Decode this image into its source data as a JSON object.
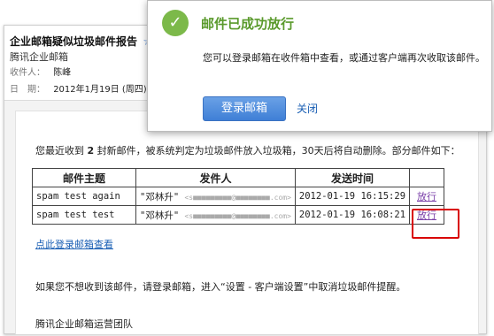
{
  "email": {
    "subject": "企业邮箱疑似垃圾邮件报告",
    "sender": "腾讯企业邮箱",
    "to_label": "收件人：",
    "to_value": "陈峰",
    "date_label": "日　期：",
    "date_value": "2012年1月19日 (周四) 16:19"
  },
  "body": {
    "intro_before": "您最近收到 ",
    "intro_count": "2",
    "intro_after": " 封新邮件，被系统判定为垃圾邮件放入垃圾箱，30天后将自动删除。部分邮件如下：",
    "table": {
      "headers": [
        "邮件主题",
        "发件人",
        "发送时间",
        ""
      ],
      "rows": [
        {
          "subject": "spam test again",
          "sender_name": "\"邓林升\"",
          "sender_email": "<s■■■■■■■■■@■■■■■■■■.com>",
          "time": "2012-01-19 16:15:29",
          "action": "放行"
        },
        {
          "subject": "spam test test",
          "sender_name": "\"邓林升\"",
          "sender_email": "<s■■■■■■■■■@■■■■■■■■.com>",
          "time": "2012-01-19 16:08:21",
          "action": "放行"
        }
      ]
    },
    "login_link": "点此登录邮箱查看",
    "footer": "如果您不想收到该邮件，请登录邮箱，进入“设置 - 客户端设置”中取消垃圾邮件提醒。",
    "signature": "腾讯企业邮箱运营团队"
  },
  "dialog": {
    "title": "邮件已成功放行",
    "message": "您可以登录邮箱在收件箱中查看，或通过客户端再次收取该邮件。",
    "login_button": "登录邮箱",
    "close": "关闭",
    "icon": "check-circle-icon"
  },
  "colors": {
    "accent": "#3f7fd6",
    "success": "#7cb94a",
    "highlight": "#d90000",
    "link_visited": "#7a3fa8"
  }
}
